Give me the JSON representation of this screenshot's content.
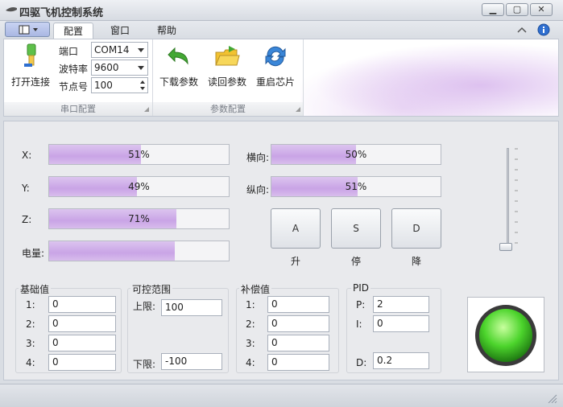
{
  "window": {
    "title": "四驱飞机控制系统"
  },
  "tabs": [
    {
      "label": "配置"
    },
    {
      "label": "窗口"
    },
    {
      "label": "帮助"
    }
  ],
  "serial": {
    "connect_label": "打开连接",
    "port_label": "端口",
    "port_value": "COM14",
    "baud_label": "波特率",
    "baud_value": "9600",
    "node_label": "节点号",
    "node_value": "100",
    "group_label": "串口配置"
  },
  "params": {
    "download_label": "下载参数",
    "readback_label": "读回参数",
    "restart_label": "重启芯片",
    "group_label": "参数配置"
  },
  "gauges": {
    "x": {
      "label": "X:",
      "value": 51,
      "text": "51%"
    },
    "y": {
      "label": "Y:",
      "value": 49,
      "text": "49%"
    },
    "z": {
      "label": "Z:",
      "value": 71,
      "text": "71%"
    },
    "power": {
      "label": "电量:",
      "value": 70,
      "text": ""
    },
    "lateral": {
      "label": "横向:",
      "value": 50,
      "text": "50%"
    },
    "longitudinal": {
      "label": "纵向:",
      "value": 51,
      "text": "51%"
    }
  },
  "keys": [
    {
      "key": "A",
      "caption": "升"
    },
    {
      "key": "S",
      "caption": "停"
    },
    {
      "key": "D",
      "caption": "降"
    }
  ],
  "slider": {
    "value": 0
  },
  "base": {
    "title": "基础值",
    "rows": [
      {
        "label": "1:",
        "value": "0"
      },
      {
        "label": "2:",
        "value": "0"
      },
      {
        "label": "3:",
        "value": "0"
      },
      {
        "label": "4:",
        "value": "0"
      }
    ]
  },
  "range": {
    "title": "可控范围",
    "upper_label": "上限:",
    "upper_value": "100",
    "lower_label": "下限:",
    "lower_value": "-100"
  },
  "comp": {
    "title": "补偿值",
    "rows": [
      {
        "label": "1:",
        "value": "0"
      },
      {
        "label": "2:",
        "value": "0"
      },
      {
        "label": "3:",
        "value": "0"
      },
      {
        "label": "4:",
        "value": "0"
      }
    ]
  },
  "pid": {
    "title": "PID",
    "p_label": "P:",
    "p_value": "2",
    "i_label": "I:",
    "i_value": "0",
    "d_label": "D:",
    "d_value": "0.2"
  },
  "colors": {
    "indicator": "#4cd42c",
    "accent": "#c9a4e6"
  }
}
